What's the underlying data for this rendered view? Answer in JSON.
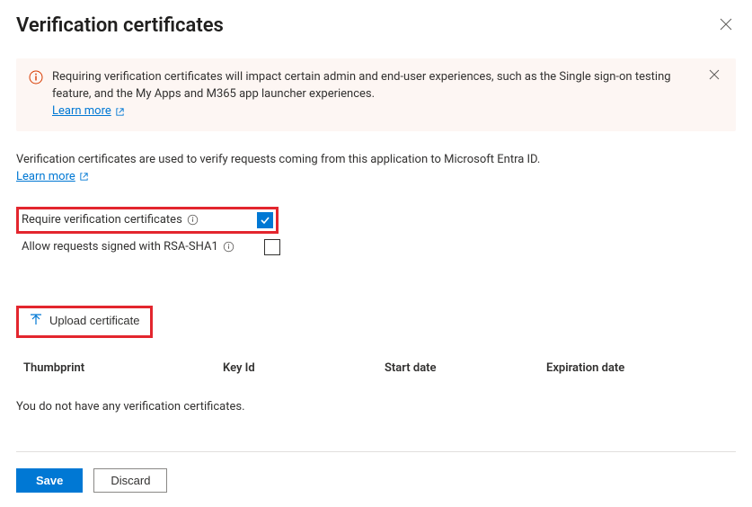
{
  "header": {
    "title": "Verification certificates"
  },
  "banner": {
    "text": "Requiring verification certificates will impact certain admin and end-user experiences, such as the Single sign-on testing feature, and the My Apps and M365 app launcher experiences.",
    "learn_more": "Learn more"
  },
  "description": "Verification certificates are used to verify requests coming from this application to Microsoft Entra ID.",
  "learn_more": "Learn more",
  "options": {
    "require_label": "Require verification certificates",
    "require_checked": true,
    "allow_rsa_label": "Allow requests signed with RSA-SHA1",
    "allow_rsa_checked": false
  },
  "upload": {
    "label": "Upload certificate"
  },
  "table": {
    "headers": {
      "thumbprint": "Thumbprint",
      "key_id": "Key Id",
      "start_date": "Start date",
      "expiration_date": "Expiration date"
    },
    "empty_message": "You do not have any verification certificates."
  },
  "footer": {
    "save": "Save",
    "discard": "Discard"
  }
}
